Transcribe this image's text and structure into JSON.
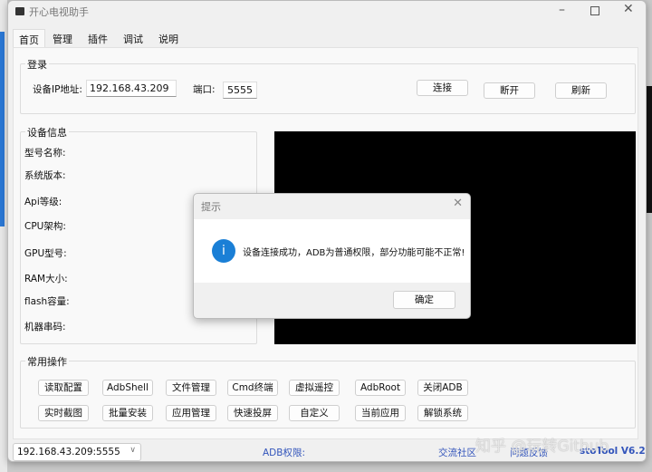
{
  "window": {
    "title": "开心电视助手",
    "controls": [
      "minimize",
      "maximize",
      "close"
    ]
  },
  "tabs": [
    "首页",
    "管理",
    "插件",
    "调试",
    "说明"
  ],
  "login": {
    "title": "登录",
    "ip_label": "设备IP地址:",
    "ip_value": "192.168.43.209",
    "port_label": "端口:",
    "port_value": "5555",
    "buttons": [
      "连接",
      "断开",
      "刷新"
    ]
  },
  "device_info": {
    "title": "设备信息",
    "fields": [
      "型号名称:",
      "系统版本:",
      "Api等级:",
      "CPU架构:",
      "GPU型号:",
      "RAM大小:",
      "flash容量:",
      "机器串码:"
    ]
  },
  "operations": {
    "title": "常用操作",
    "row1": [
      "读取配置",
      "AdbShell",
      "文件管理",
      "Cmd终端",
      "虚拟遥控",
      "AdbRoot",
      "关闭ADB"
    ],
    "row2": [
      "实时截图",
      "批量安装",
      "应用管理",
      "快速投屏",
      "自定义",
      "当前应用",
      "解锁系统"
    ]
  },
  "status": {
    "device_select": "192.168.43.209:5555",
    "adb_label": "ADB权限:",
    "community": "交流社区",
    "feedback": "问题反馈",
    "version": "stoTool V6.2"
  },
  "watermark": "知乎 @玩转Github",
  "dialog": {
    "title": "提示",
    "message": "设备连接成功，ADB为普通权限，部分功能可能不正常!",
    "ok": "确定",
    "icon": "info-icon"
  },
  "colors": {
    "link": "#3355bb",
    "info": "#1a7fd6",
    "screen": "#000000"
  }
}
